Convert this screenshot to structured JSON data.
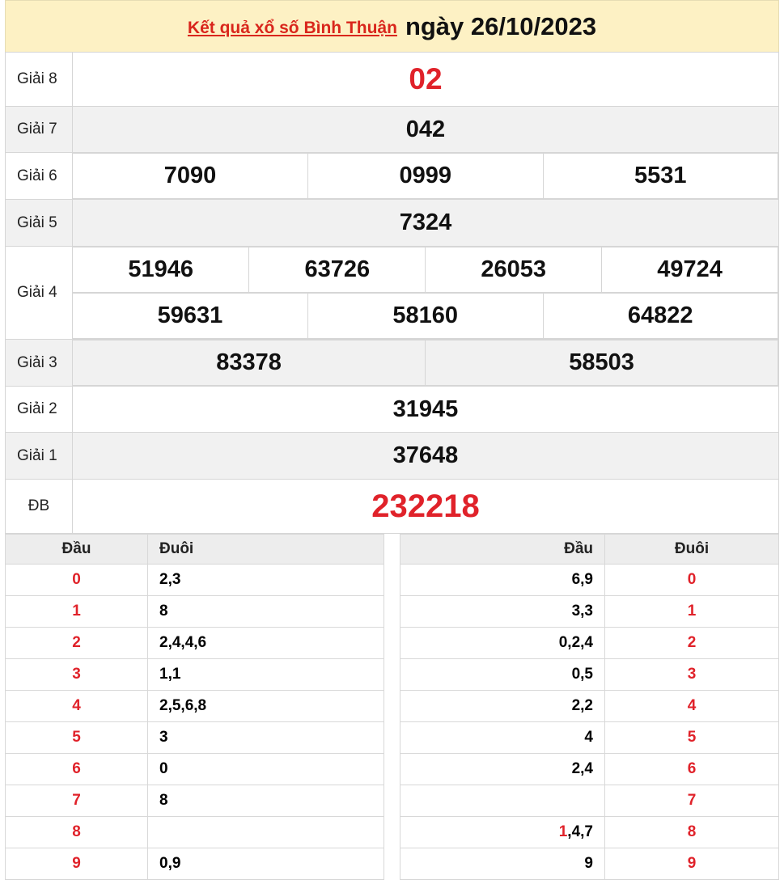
{
  "header": {
    "title_link": "Kết quả xổ số Bình Thuận",
    "date_text": "ngày 26/10/2023"
  },
  "prizes": {
    "g8": {
      "label": "Giải 8",
      "values": [
        "02"
      ]
    },
    "g7": {
      "label": "Giải 7",
      "values": [
        "042"
      ]
    },
    "g6": {
      "label": "Giải 6",
      "values": [
        "7090",
        "0999",
        "5531"
      ]
    },
    "g5": {
      "label": "Giải 5",
      "values": [
        "7324"
      ]
    },
    "g4": {
      "label": "Giải 4",
      "values": [
        "51946",
        "63726",
        "26053",
        "49724",
        "59631",
        "58160",
        "64822"
      ]
    },
    "g3": {
      "label": "Giải 3",
      "values": [
        "83378",
        "58503"
      ]
    },
    "g2": {
      "label": "Giải 2",
      "values": [
        "31945"
      ]
    },
    "g1": {
      "label": "Giải 1",
      "values": [
        "37648"
      ]
    },
    "db": {
      "label": "ĐB",
      "values": [
        "232218"
      ]
    }
  },
  "stats_left": {
    "headers": [
      "Đầu",
      "Đuôi"
    ],
    "rows": [
      {
        "head": "0",
        "tail": "2,3"
      },
      {
        "head": "1",
        "tail": "8"
      },
      {
        "head": "2",
        "tail": "2,4,4,6"
      },
      {
        "head": "3",
        "tail": "1,1"
      },
      {
        "head": "4",
        "tail": "2,5,6,8"
      },
      {
        "head": "5",
        "tail": "3"
      },
      {
        "head": "6",
        "tail": "0"
      },
      {
        "head": "7",
        "tail": "8"
      },
      {
        "head": "8",
        "tail": ""
      },
      {
        "head": "9",
        "tail": "0,9"
      }
    ]
  },
  "stats_right": {
    "headers": [
      "Đầu",
      "Đuôi"
    ],
    "rows": [
      {
        "head_red": "",
        "head": "6,9",
        "tail": "0"
      },
      {
        "head_red": "",
        "head": "3,3",
        "tail": "1"
      },
      {
        "head_red": "",
        "head": "0,2,4",
        "tail": "2"
      },
      {
        "head_red": "",
        "head": "0,5",
        "tail": "3"
      },
      {
        "head_red": "",
        "head": "2,2",
        "tail": "4"
      },
      {
        "head_red": "",
        "head": "4",
        "tail": "5"
      },
      {
        "head_red": "",
        "head": "2,4",
        "tail": "6"
      },
      {
        "head_red": "",
        "head": "",
        "tail": "7"
      },
      {
        "head_red": "1",
        "head": ",4,7",
        "tail": "8"
      },
      {
        "head_red": "",
        "head": "9",
        "tail": "9"
      }
    ]
  },
  "colors": {
    "accent_red": "#e0222a",
    "header_bg": "#fdf1c4",
    "alt_row_bg": "#f1f1f1"
  }
}
